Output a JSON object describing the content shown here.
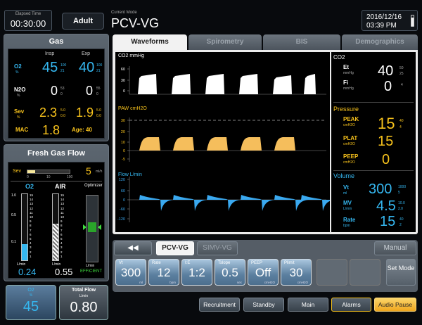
{
  "header": {
    "elapsed_label": "Elapsed Time",
    "elapsed": "00:30:00",
    "patient": "Adult",
    "mode_label": "Current Mode",
    "mode": "PCV-VG",
    "date": "2016/12/16",
    "time": "03:39 PM"
  },
  "gas": {
    "title": "Gas",
    "insp": "Insp",
    "exp": "Exp",
    "o2": {
      "name": "O2",
      "unit": "%",
      "insp": "45",
      "insp_hi": "100",
      "insp_lo": "21",
      "exp": "40",
      "exp_hi": "100",
      "exp_lo": "21"
    },
    "n2o": {
      "name": "N2O",
      "unit": "%",
      "insp": "0",
      "insp_hi": "53",
      "insp_lo": "0",
      "exp": "0",
      "exp_hi": "55",
      "exp_lo": "0"
    },
    "sev": {
      "name": "Sev",
      "unit": "%",
      "insp": "2.3",
      "insp_hi": "5.0",
      "insp_lo": "0.0",
      "exp": "1.9",
      "exp_hi": "5.0",
      "exp_lo": "0.0"
    },
    "mac_label": "MAC",
    "mac": "1.8",
    "age": "Age: 40"
  },
  "fgf": {
    "title": "Fresh Gas Flow",
    "agent": "Sev",
    "agent_min": "0",
    "agent_mid": "10",
    "agent_max": "100",
    "agent_value": "5",
    "agent_unit": "ml/h",
    "agent_fill": 0.18,
    "o2_label": "O2",
    "air_label": "AIR",
    "optimizer": "Optimizer",
    "lmin": "L/min",
    "scale_left": [
      "1.0",
      "0.5",
      "0.1"
    ],
    "scale_right": [
      "15",
      "14",
      "13",
      "12",
      "11",
      "10",
      "9",
      "8",
      "7",
      "6",
      "5",
      "4",
      "3",
      "2",
      "1"
    ],
    "o2_value": "0.24",
    "air_value": "0.55",
    "efficient": "EFFICIENT",
    "o2_fill": 0.24,
    "air_fill": 0.55
  },
  "bottom_left": {
    "o2_label": "O2",
    "o2_unit": "%",
    "o2_value": "45",
    "total_label": "Total Flow",
    "total_unit": "L/min",
    "total_value": "0.80"
  },
  "tabs": [
    "Waveforms",
    "Spirometry",
    "BIS",
    "Demographics"
  ],
  "waves": {
    "co2_label": "CO2 mmHg",
    "co2_ticks": [
      "60",
      "30",
      "0"
    ],
    "paw_label": "PAW cmH2O",
    "paw_ticks": [
      "30",
      "20",
      "10",
      "0",
      "-5"
    ],
    "flow_label": "Flow L/min",
    "flow_ticks": [
      "120",
      "60",
      "0",
      "-60",
      "-120"
    ]
  },
  "readouts": {
    "co2_title": "CO2",
    "et_label": "Et",
    "et_unit": "mmHg",
    "et_value": "40",
    "et_hi": "50",
    "et_lo": "25",
    "fi_label": "Fi",
    "fi_unit": "mmHg",
    "fi_value": "0",
    "fi_hi": "4",
    "pressure_title": "Pressure",
    "peak_label": "PEAK",
    "peak_unit": "cmH2O",
    "peak_value": "15",
    "peak_hi": "40",
    "peak_lo": "4",
    "plat_label": "PLAT",
    "plat_unit": "cmH2O",
    "plat_value": "15",
    "peep_label": "PEEP",
    "peep_unit": "cmH2O",
    "peep_value": "0",
    "volume_title": "Volume",
    "vt_label": "Vt",
    "vt_unit": "ml",
    "vt_value": "300",
    "vt_hi": "1000",
    "vt_lo": "5",
    "mv_label": "MV",
    "mv_unit": "L/min",
    "mv_value": "4.5",
    "mv_hi": "10.0",
    "mv_lo": "2.0",
    "rate_label": "Rate",
    "rate_unit": "bpm",
    "rate_value": "15",
    "rate_hi": "40",
    "rate_lo": "2"
  },
  "mode_bar": {
    "back": "◀◀",
    "current": "PCV-VG",
    "other": "SIMV-VG",
    "manual": "Manual"
  },
  "params": [
    {
      "label": "Vt",
      "value": "300",
      "unit": "ml"
    },
    {
      "label": "Rate",
      "value": "12",
      "unit": "bpm"
    },
    {
      "label": "I:E",
      "value": "1:2",
      "unit": ""
    },
    {
      "label": "Tslope",
      "value": "0.5",
      "unit": "sec"
    },
    {
      "label": "PEEP",
      "value": "Off",
      "unit": "cmH2O"
    },
    {
      "label": "Plimit",
      "value": "30",
      "unit": "cmH2O"
    }
  ],
  "set_mode": "Set Mode",
  "actions": {
    "recruitment": "Recruitment",
    "standby": "Standby",
    "main": "Main",
    "alarms": "Alarms",
    "audio_pause": "Audio Pause"
  },
  "colors": {
    "cyan": "#35b7f0",
    "yellow": "#f7c21c",
    "green": "#3fdd3f",
    "paw_fill": "#f5be5c",
    "flow": "#3aa9f0"
  }
}
